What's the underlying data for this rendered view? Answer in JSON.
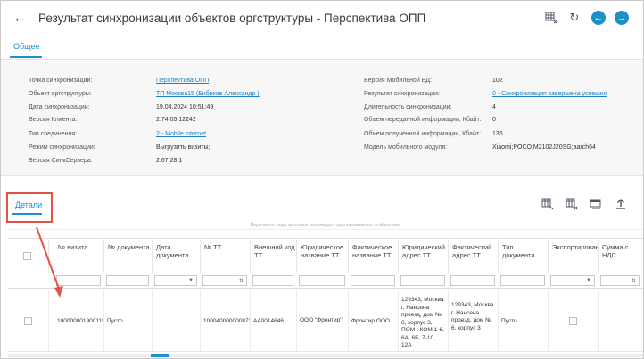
{
  "header": {
    "title": "Результат синхронизации объектов оргструктуры - Перспектива ОПП",
    "icons": [
      "back-arrow-icon",
      "grid-settings-icon",
      "refresh-icon",
      "prev-circle-icon",
      "next-circle-icon"
    ]
  },
  "tabs": {
    "general": "Общее",
    "details": "Детали"
  },
  "details_left": [
    {
      "label": "Точка синхронизации:",
      "value": "Перспектива ОПП",
      "link": true
    },
    {
      "label": "Объект оргструктуры:",
      "value": "ТП Москва15 (Бибиков Александр )",
      "link": true
    },
    {
      "label": "Дата синхронизации:",
      "value": "19.04.2024 10:51:49",
      "link": false
    },
    {
      "label": "Версия Клиента:",
      "value": "2.74.05.12242",
      "link": false
    },
    {
      "label": "Тип соединения:",
      "value": "2 - Mobile internet",
      "link": true
    },
    {
      "label": "Режим синхронизации:",
      "value": "Выгрузить визиты;",
      "link": false
    },
    {
      "label": "Версия СинкСервера:",
      "value": "2.67.28.1",
      "link": false
    }
  ],
  "details_right": [
    {
      "label": "Версия Мобильной БД:",
      "value": "102",
      "link": false
    },
    {
      "label": "Результат синхронизации:",
      "value": "0 - Синхронизация завершена успешно",
      "link": true
    },
    {
      "label": "Длительность синхронизации:",
      "value": "4",
      "link": false
    },
    {
      "label": "Объем переданной информации, Кбайт:",
      "value": "0",
      "link": false
    },
    {
      "label": "Объем полученной информации, Кбайт:",
      "value": "136",
      "link": false
    },
    {
      "label": "Модель мобильного модуля:",
      "value": "Xiaomi;POCO;M2102J20SG;aarch64",
      "link": false
    }
  ],
  "group_hint": "Перетяните сюда заголовок колонки для группирования по этой колонке",
  "columns": [
    "№ визита",
    "№ документа",
    "Дата документа",
    "№ ТТ",
    "Внешний код ТТ",
    "Юридическое название ТТ",
    "Фактическое название ТТ",
    "Юридический адрес ТТ",
    "Фактический адрес ТТ",
    "Тип документа",
    "Экспортирован",
    "Сумма с НДС"
  ],
  "row": {
    "visit": "100000001900115",
    "doc_no": "Пусто",
    "doc_date": "",
    "tt_no": "100040000000873",
    "ext_code": "АА0014646",
    "legal_name": "ООО \"Фронтир\"",
    "actual_name": "Фронтир ООО",
    "legal_addr": "129343, Москва г, Нансена проезд, дом № 6, корпус 3, ПОМ I КОМ 1-6, 6А, 6Б, 7-10, 12А",
    "actual_addr": "129343, Москва г, Нансена проезд, дом № 6, корпус 3",
    "doc_type": "Пусто",
    "exported": "",
    "sum": ""
  }
}
